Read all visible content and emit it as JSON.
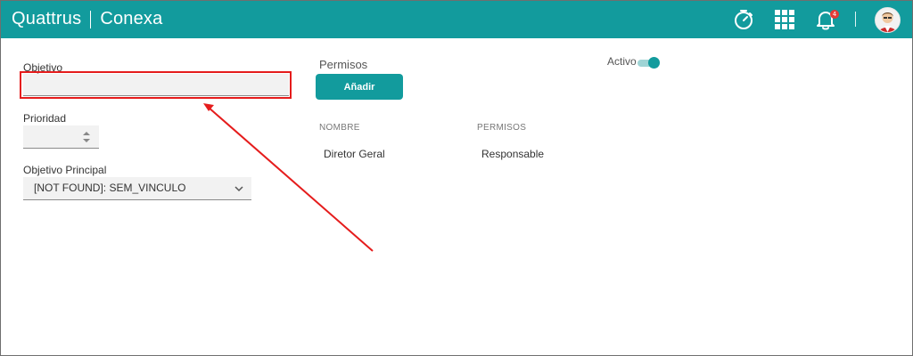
{
  "app": {
    "brand_left": "Quattrus",
    "brand_right": "Conexa"
  },
  "header": {
    "icons": [
      "stopwatch-icon",
      "apps-grid-icon",
      "bell-icon",
      "user-avatar"
    ],
    "notification_count": "4"
  },
  "form": {
    "objetivo_label": "Objetivo",
    "objetivo_value": "",
    "prioridad_label": "Prioridad",
    "prioridad_value": "",
    "objetivo_principal_label": "Objetivo Principal",
    "objetivo_principal_value": "[NOT FOUND]: SEM_VINCULO"
  },
  "permisos": {
    "title": "Permisos",
    "add_button": "Añadir",
    "columns": [
      "NOMBRE",
      "PERMISOS"
    ],
    "rows": [
      [
        "Diretor Geral",
        "Responsable"
      ]
    ]
  },
  "status": {
    "activo_label": "Activo",
    "activo_on": true
  },
  "colors": {
    "primary": "#129b9d",
    "highlight": "#e51c1c"
  }
}
